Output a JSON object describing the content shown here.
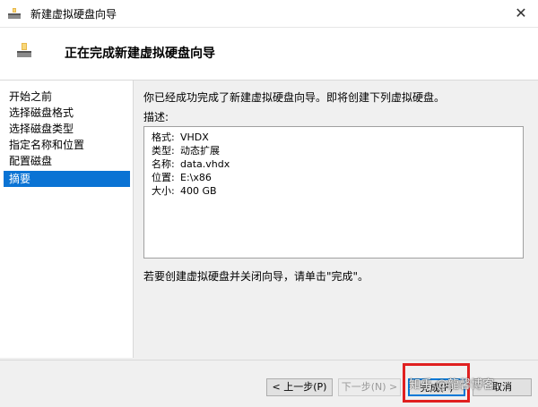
{
  "window": {
    "title": "新建虚拟硬盘向导",
    "close_glyph": "✕"
  },
  "header": {
    "title": "正在完成新建虚拟硬盘向导"
  },
  "sidebar": {
    "items": [
      {
        "label": "开始之前"
      },
      {
        "label": "选择磁盘格式"
      },
      {
        "label": "选择磁盘类型"
      },
      {
        "label": "指定名称和位置"
      },
      {
        "label": "配置磁盘"
      },
      {
        "label": "摘要",
        "selected": true
      }
    ]
  },
  "content": {
    "intro": "你已经成功完成了新建虚拟硬盘向导。即将创建下列虚拟硬盘。",
    "description_label": "描述:",
    "summary": [
      {
        "key": "格式:",
        "value": "VHDX"
      },
      {
        "key": "类型:",
        "value": "动态扩展"
      },
      {
        "key": "名称:",
        "value": "data.vhdx"
      },
      {
        "key": "位置:",
        "value": "E:\\x86"
      },
      {
        "key": "大小:",
        "value": "400 GB"
      }
    ],
    "hint": "若要创建虚拟硬盘并关闭向导，请单击\"完成\"。"
  },
  "buttons": {
    "prev": "< 上一步(P)",
    "next": "下一步(N) >",
    "finish": "完成(F)",
    "cancel": "取消"
  },
  "watermark": "知乎 @龍馨博客",
  "colors": {
    "selection": "#0a73d4",
    "highlight_box": "#e02020"
  }
}
